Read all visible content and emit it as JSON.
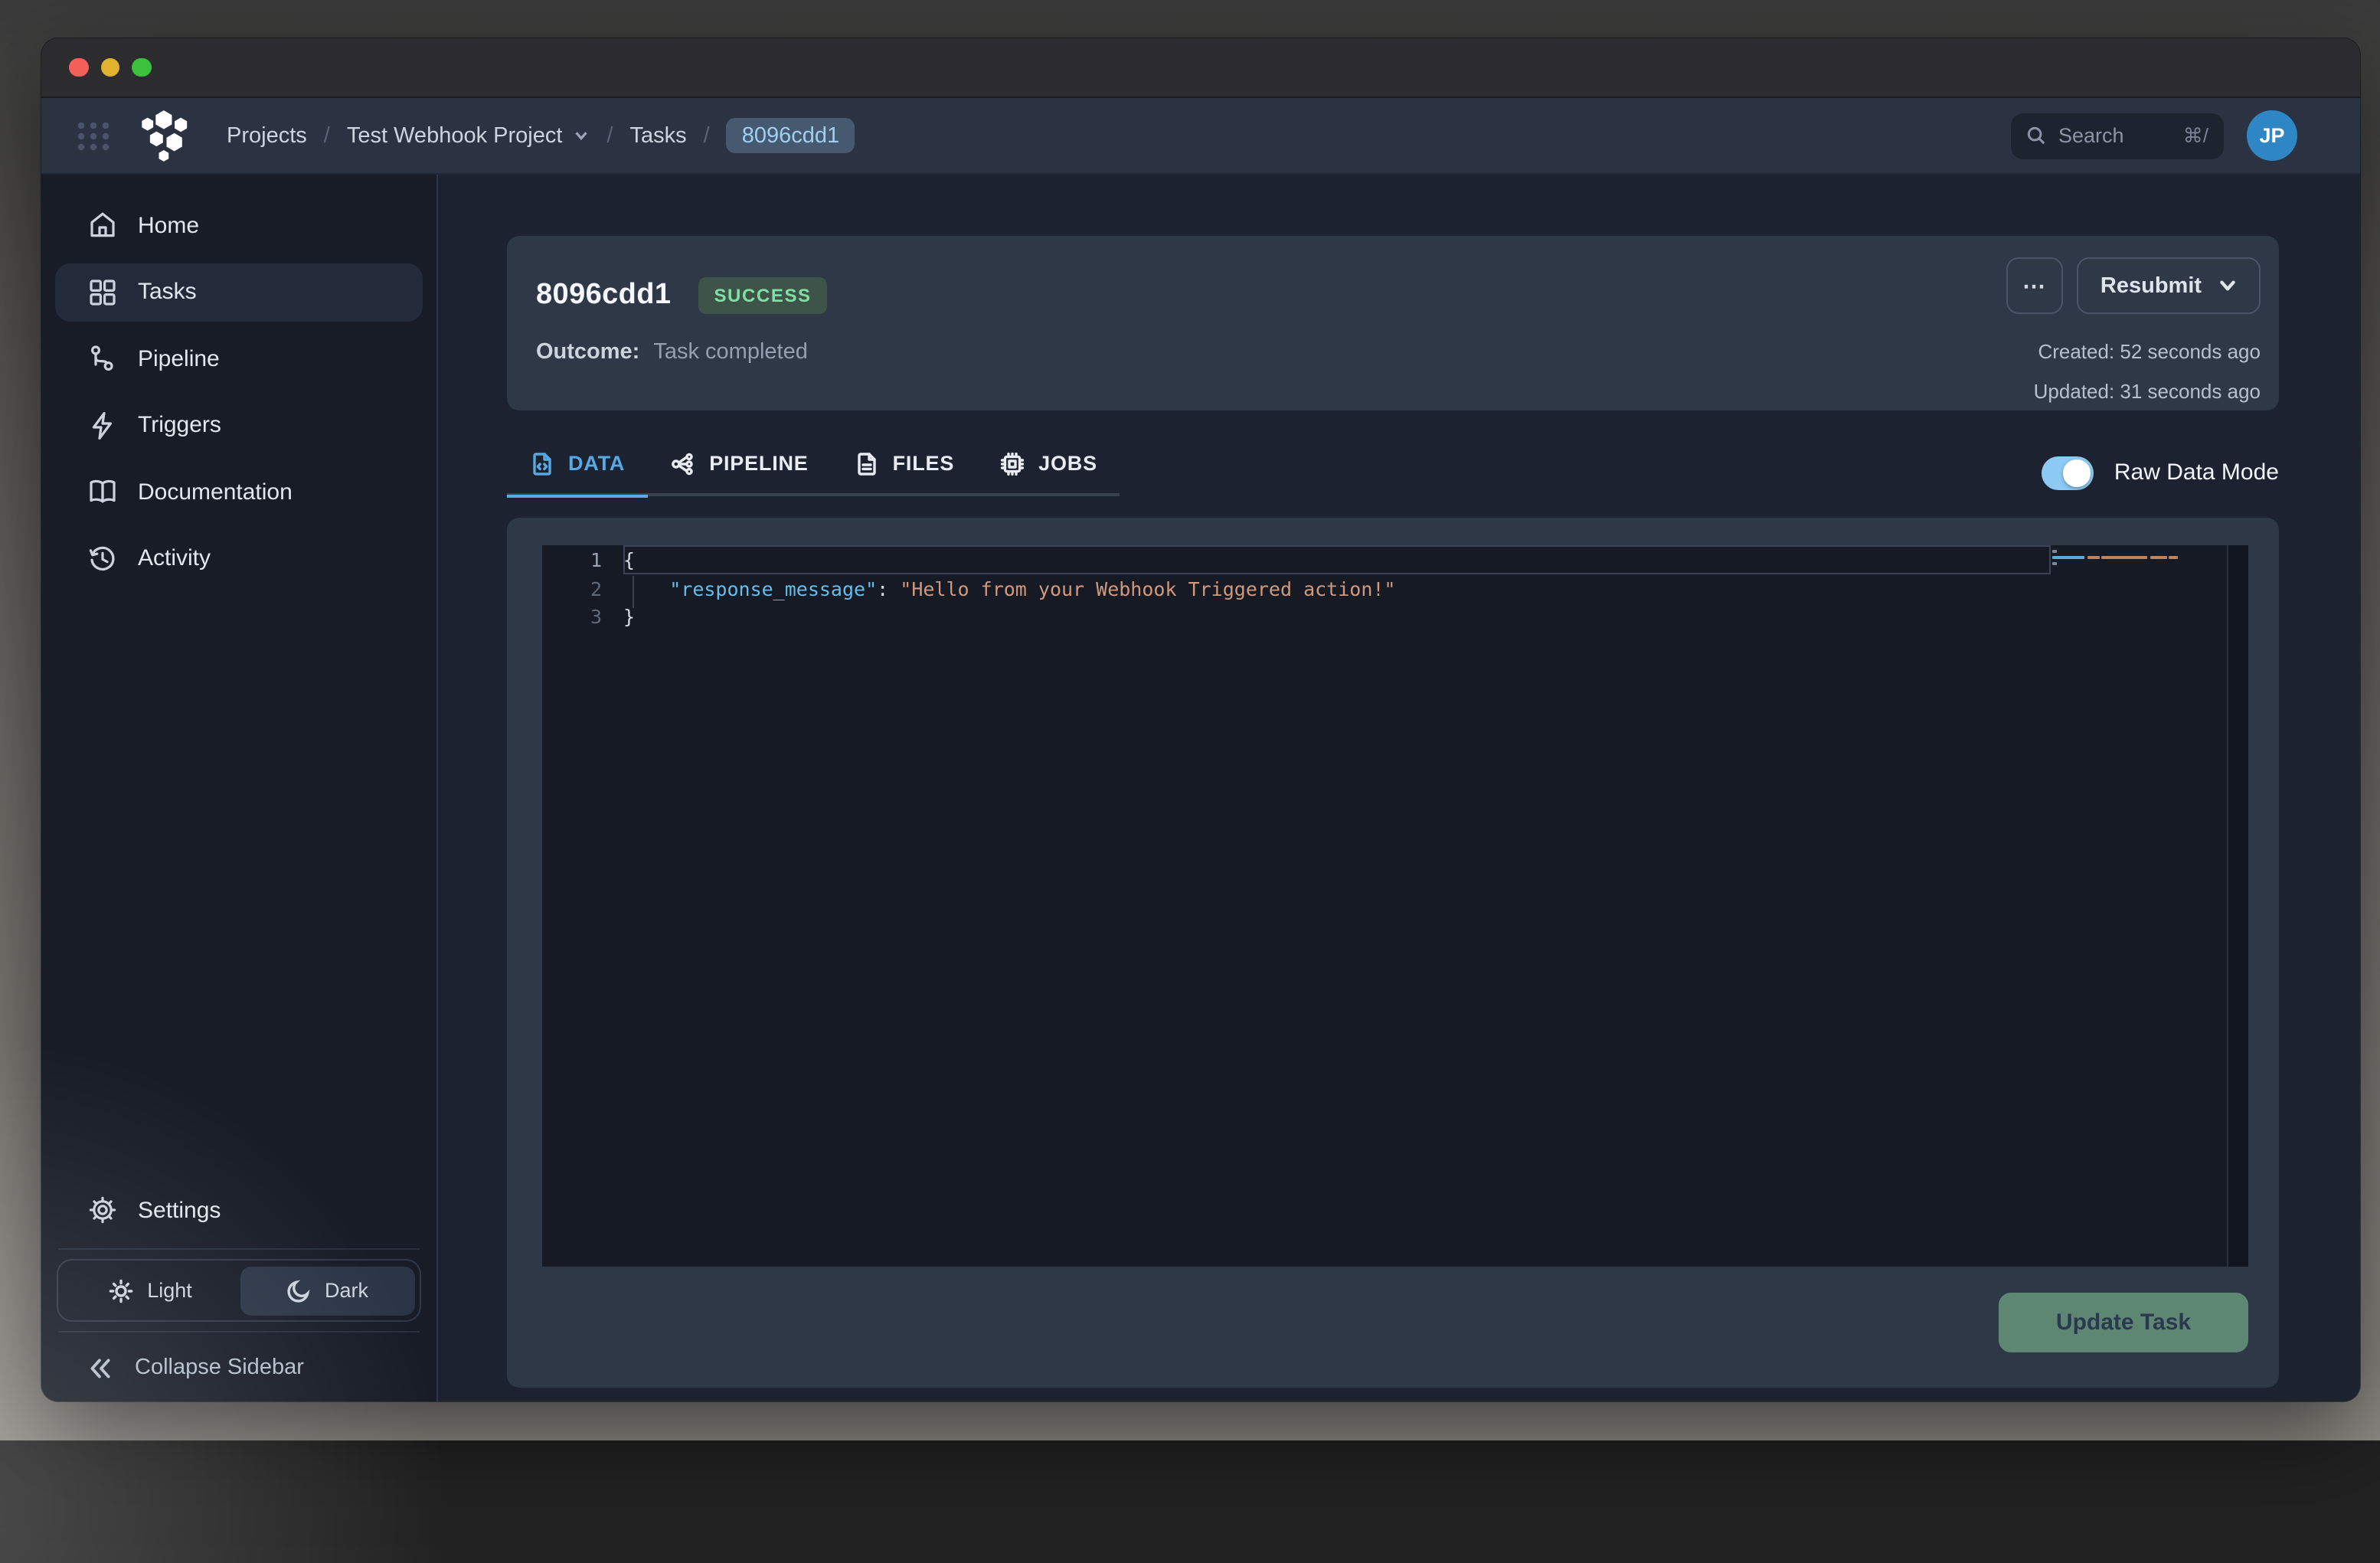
{
  "window": {
    "traffic_lights": [
      "close",
      "minimize",
      "zoom"
    ]
  },
  "topnav": {
    "breadcrumb": {
      "separator": "/",
      "items": [
        "Projects",
        "Test Webhook Project",
        "Tasks",
        "8096cdd1"
      ]
    },
    "search": {
      "placeholder": "Search",
      "shortcut": "⌘/"
    },
    "avatar_initials": "JP"
  },
  "sidebar": {
    "items": [
      {
        "label": "Home",
        "active": false
      },
      {
        "label": "Tasks",
        "active": true
      },
      {
        "label": "Pipeline",
        "active": false
      },
      {
        "label": "Triggers",
        "active": false
      },
      {
        "label": "Documentation",
        "active": false
      },
      {
        "label": "Activity",
        "active": false
      }
    ],
    "settings_label": "Settings",
    "theme": {
      "light_label": "Light",
      "dark_label": "Dark",
      "selected": "Dark"
    },
    "collapse_label": "Collapse Sidebar"
  },
  "task": {
    "id": "8096cdd1",
    "status": "SUCCESS",
    "outcome_label": "Outcome:",
    "outcome": "Task completed",
    "more_label": "⋯",
    "resubmit_label": "Resubmit",
    "created": "Created: 52 seconds ago",
    "updated": "Updated: 31 seconds ago"
  },
  "tabs": [
    {
      "label": "DATA",
      "active": true
    },
    {
      "label": "PIPELINE",
      "active": false
    },
    {
      "label": "FILES",
      "active": false
    },
    {
      "label": "JOBS",
      "active": false
    }
  ],
  "raw_mode": {
    "label": "Raw Data Mode",
    "enabled": true
  },
  "editor": {
    "lines": [
      {
        "num": "1",
        "tokens": [
          {
            "t": "{"
          }
        ]
      },
      {
        "num": "2",
        "tokens": [
          {
            "t": "    "
          },
          {
            "t": "\"response_message\""
          },
          {
            "t": ": "
          },
          {
            "t": "\"Hello from your Webhook Triggered action!\""
          }
        ]
      },
      {
        "num": "3",
        "tokens": [
          {
            "t": "}"
          }
        ]
      }
    ]
  },
  "footer": {
    "update_label": "Update Task"
  },
  "colors": {
    "accent_blue": "#57a8e3",
    "success_badge_bg": "#3e5449",
    "success_badge_text": "#80dfa3",
    "update_button_green": "#5d8673",
    "toggle_blue": "#8ccaf3",
    "avatar_blue": "#2f86c4",
    "string_token": "#d0997d",
    "key_token": "#68bce9"
  }
}
